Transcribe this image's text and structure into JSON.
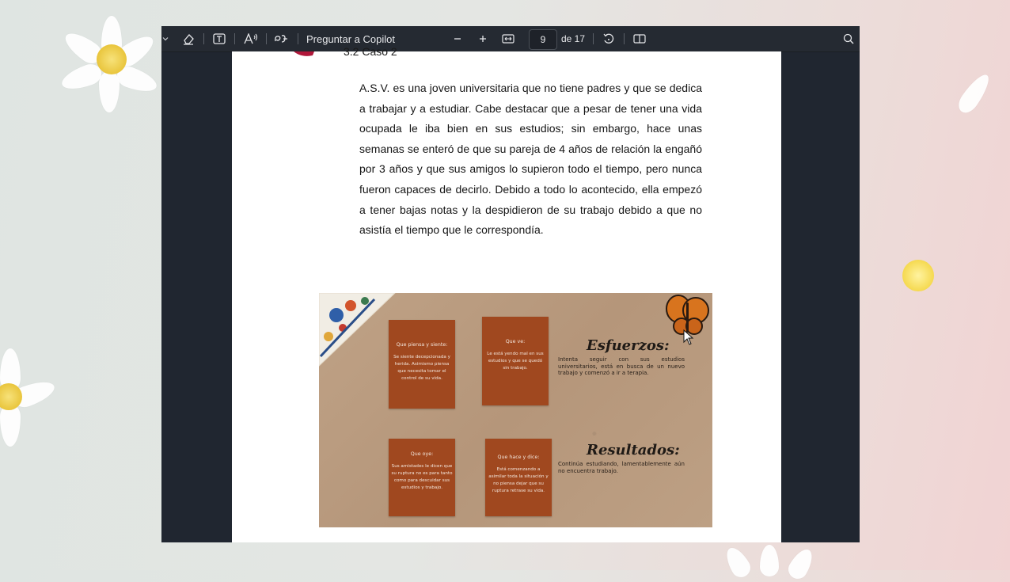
{
  "toolbar": {
    "copilot_label": "Preguntar a Copilot",
    "page_number": "9",
    "page_total": "de 17",
    "icons": [
      "chevron-down-icon",
      "eraser-icon",
      "text-box-icon",
      "read-aloud-icon",
      "translate-icon",
      "zoom-out-icon",
      "zoom-in-icon",
      "fit-width-icon",
      "rotate-icon",
      "page-view-icon",
      "search-icon"
    ]
  },
  "document": {
    "section_heading": "3.2 Caso 2",
    "paragraph": "A.S.V. es una joven universitaria que no tiene padres y que se dedica a trabajar y a estudiar. Cabe destacar que a pesar de tener una vida ocupada le iba bien en sus estudios; sin embargo, hace unas semanas se enteró de que su pareja de 4 años de relación la engañó por 3 años y que sus amigos lo supieron todo el tiempo, pero nunca fueron capaces de decirlo. Debido a todo lo acontecido, ella empezó a tener bajas notas y la despidieron de su trabajo debido a que no asistía el tiempo que le correspondía."
  },
  "infographic": {
    "boxes": [
      {
        "title": "Que piensa y siente:",
        "text": "Se siente decepcionada y herida. Asimismo piensa que necesita tomar el control de su vida."
      },
      {
        "title": "Que ve:",
        "text": "Le está yendo mal en sus estudios y que se quedó sin trabajo."
      },
      {
        "title": "Que oye:",
        "text": "Sus amistades le dicen que su ruptura no es para tanto como para descuidar sus estudios y trabajo."
      },
      {
        "title": "Que hace y dice:",
        "text": "Está comenzando a asimilar toda la situación y no piensa dejar que su ruptura retrase su vida."
      }
    ],
    "esfuerzos_title": "Esfuerzos:",
    "esfuerzos_text": "Intenta seguir con sus estudios universitarios, está en busca de un nuevo trabajo y comenzó a ir a terapia.",
    "resultados_title": "Resultados:",
    "resultados_text": "Continúa estudiando, lamentablemente aún no encuentra trabajo."
  },
  "colors": {
    "toolbar_bg": "#252a32",
    "viewer_bg": "#202630",
    "box_fill": "#a0481f",
    "kraft": "#b89a7e"
  }
}
